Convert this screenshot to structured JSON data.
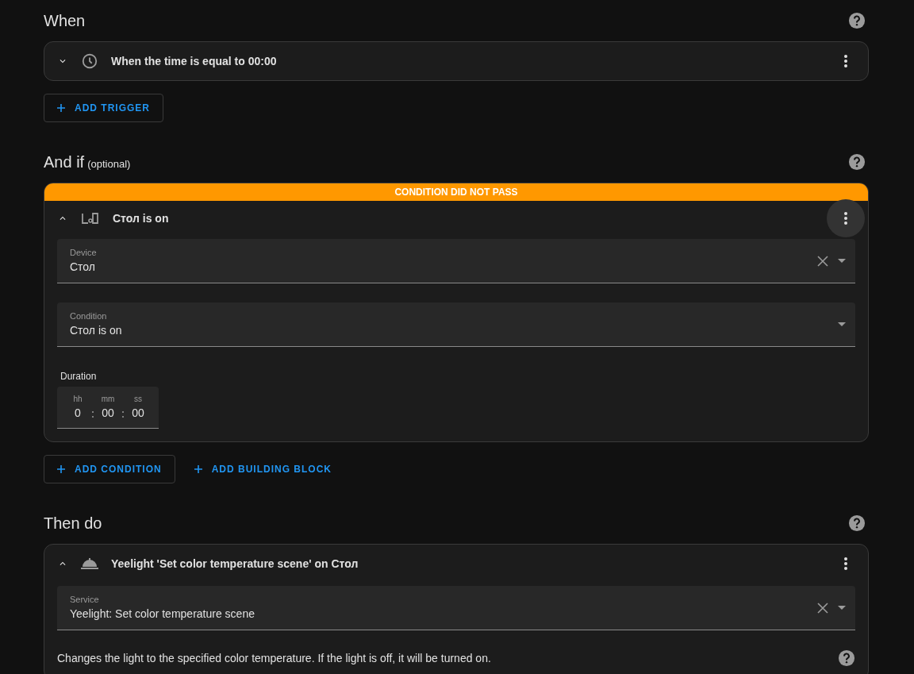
{
  "sections": [
    {
      "title": "When",
      "cards": [
        {
          "kind": "trigger",
          "expanded": false,
          "title": "When the time is equal to 00:00",
          "menu_hovered": false
        }
      ],
      "buttons": [
        {
          "label": "ADD TRIGGER",
          "outlined": true
        }
      ]
    },
    {
      "title": "And if",
      "subtitle": "(optional)",
      "cards": [
        {
          "kind": "device_condition",
          "expanded": true,
          "title": "Стол is on",
          "banner": "CONDITION DID NOT PASS",
          "menu_hovered": true,
          "fields": [
            {
              "kind": "select",
              "label": "Device",
              "value": "Стол",
              "clearable": true
            },
            {
              "kind": "select",
              "label": "Condition",
              "value": "Стол is on",
              "clearable": false
            },
            {
              "kind": "duration",
              "label": "Duration",
              "units": [
                {
                  "label": "hh",
                  "value": "0"
                },
                {
                  "label": "mm",
                  "value": "00"
                },
                {
                  "label": "ss",
                  "value": "00"
                }
              ]
            }
          ]
        }
      ],
      "buttons": [
        {
          "label": "ADD CONDITION",
          "outlined": true
        },
        {
          "label": "ADD BUILDING BLOCK",
          "outlined": false
        }
      ]
    },
    {
      "title": "Then do",
      "cards": [
        {
          "kind": "service_action",
          "expanded": true,
          "title": "Yeelight 'Set color temperature scene' on Стол",
          "menu_hovered": false,
          "fields": [
            {
              "kind": "select",
              "label": "Service",
              "value": "Yeelight: Set color temperature scene",
              "clearable": true
            },
            {
              "kind": "description",
              "text": "Changes the light to the specified color temperature. If the light is off, it will be turned on."
            }
          ]
        }
      ]
    }
  ]
}
